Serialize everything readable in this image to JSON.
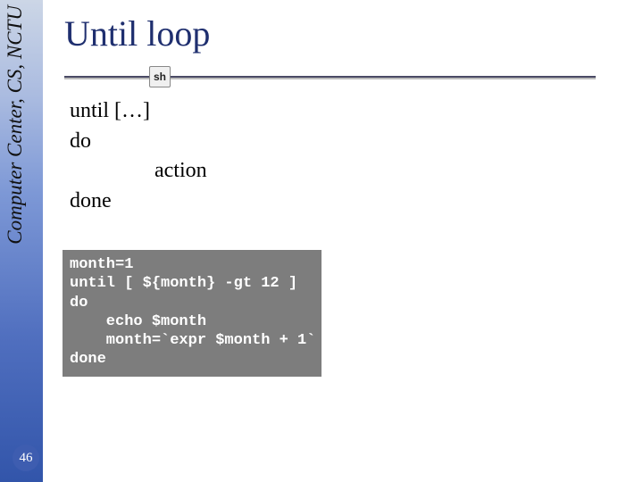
{
  "sidebar": {
    "org_text": "Computer Center, CS, NCTU"
  },
  "slide": {
    "number": "46",
    "title": "Until loop",
    "sh_label": "sh"
  },
  "syntax": {
    "line1": "until […]",
    "line2": "do",
    "line3": "action",
    "line4": "done"
  },
  "code": {
    "line1": "month=1",
    "line2": "until [ ${month} -gt 12 ]",
    "line3": "do",
    "line4": "    echo $month",
    "line5": "    month=`expr $month + 1`",
    "line6": "done"
  }
}
